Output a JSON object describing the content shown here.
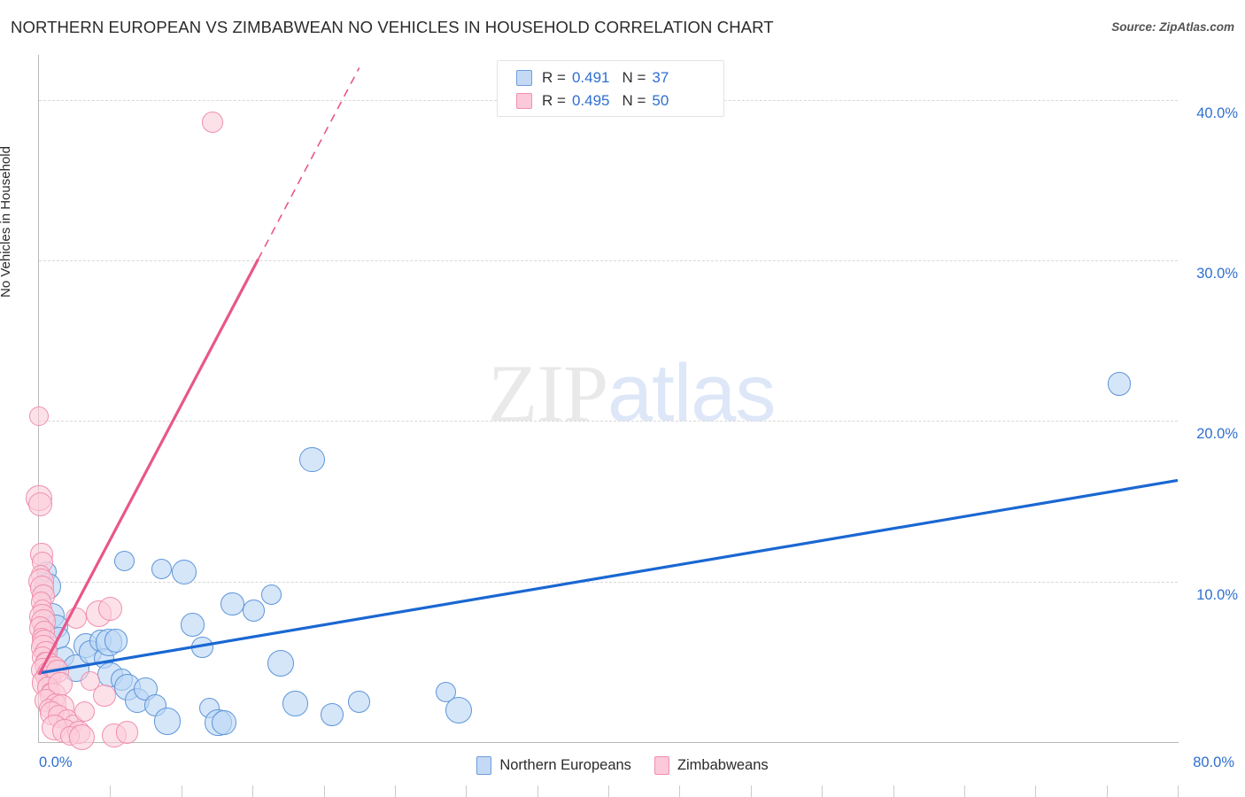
{
  "header": {
    "title": "NORTHERN EUROPEAN VS ZIMBABWEAN NO VEHICLES IN HOUSEHOLD CORRELATION CHART",
    "source": "Source: ZipAtlas.com"
  },
  "watermark": {
    "part1": "ZIP",
    "part2": "atlas"
  },
  "stats": {
    "rows": [
      {
        "series": "Northern Europeans",
        "r_label": "R =",
        "r_value": "0.491",
        "n_label": "N =",
        "n_value": "37",
        "color": "#c3d9f5"
      },
      {
        "series": "Zimbabweans",
        "r_label": "R =",
        "r_value": "0.495",
        "n_label": "N =",
        "n_value": "50",
        "color": "#fbc9da"
      }
    ]
  },
  "series_legend": [
    {
      "label": "Northern Europeans",
      "color": "#c3d9f5"
    },
    {
      "label": "Zimbabweans",
      "color": "#fbc9da"
    }
  ],
  "chart_data": {
    "type": "scatter",
    "title": "NORTHERN EUROPEAN VS ZIMBABWEAN NO VEHICLES IN HOUSEHOLD CORRELATION CHART",
    "xlabel": "",
    "ylabel": "No Vehicles in Household",
    "xlim": [
      0,
      80
    ],
    "ylim": [
      0,
      42.8
    ],
    "x_tick_labels": [
      "0.0%",
      "80.0%"
    ],
    "y_tick_labels": [
      "40.0%",
      "30.0%",
      "20.0%",
      "10.0%"
    ],
    "y_ticks": [
      40,
      30,
      20,
      10
    ],
    "x_ticks": [
      0,
      5,
      10,
      15,
      20,
      25,
      30,
      35,
      40,
      45,
      50,
      55,
      60,
      65,
      70,
      75,
      80
    ],
    "grid": true,
    "legend_position": "bottom-center",
    "series": [
      {
        "name": "Northern Europeans",
        "color": "#c3d9f5",
        "edge_color": "#5e95d8",
        "r": 0.491,
        "n": 37,
        "trend": {
          "x0": 0.0,
          "y0": 4.3,
          "x1": 80.0,
          "y1": 16.3,
          "dashed_from": null
        },
        "points": [
          [
            0.5,
            10.6
          ],
          [
            0.6,
            9.7
          ],
          [
            0.9,
            7.9
          ],
          [
            1.2,
            7.2
          ],
          [
            1.4,
            6.5
          ],
          [
            1.8,
            5.3
          ],
          [
            2.6,
            4.6
          ],
          [
            3.3,
            6.0
          ],
          [
            3.6,
            5.6
          ],
          [
            4.3,
            6.3
          ],
          [
            4.6,
            5.2
          ],
          [
            4.9,
            6.2
          ],
          [
            5.0,
            4.2
          ],
          [
            5.4,
            6.3
          ],
          [
            5.8,
            3.9
          ],
          [
            6.0,
            11.3
          ],
          [
            6.2,
            3.4
          ],
          [
            6.9,
            2.6
          ],
          [
            7.5,
            3.3
          ],
          [
            8.2,
            2.3
          ],
          [
            8.6,
            10.8
          ],
          [
            9.0,
            1.3
          ],
          [
            10.2,
            10.6
          ],
          [
            10.8,
            7.3
          ],
          [
            11.5,
            5.9
          ],
          [
            12.0,
            2.1
          ],
          [
            12.6,
            1.2
          ],
          [
            13.0,
            1.2
          ],
          [
            13.6,
            8.6
          ],
          [
            15.1,
            8.2
          ],
          [
            16.3,
            9.2
          ],
          [
            17.0,
            4.9
          ],
          [
            18.0,
            2.4
          ],
          [
            20.6,
            1.7
          ],
          [
            22.5,
            2.5
          ],
          [
            28.6,
            3.1
          ],
          [
            29.5,
            2.0
          ],
          [
            19.2,
            17.6
          ],
          [
            75.9,
            22.3
          ]
        ]
      },
      {
        "name": "Zimbabweans",
        "color": "#fbc9da",
        "edge_color": "#ef8fae",
        "r": 0.495,
        "n": 50,
        "trend": {
          "x0": 0.0,
          "y0": 4.2,
          "x1": 22.5,
          "y1": 42.0,
          "dashed_from": 15.4
        },
        "points": [
          [
            0.0,
            20.3
          ],
          [
            0.0,
            15.2
          ],
          [
            0.1,
            14.8
          ],
          [
            0.2,
            11.7
          ],
          [
            0.25,
            11.2
          ],
          [
            0.1,
            10.4
          ],
          [
            0.15,
            10.0
          ],
          [
            0.2,
            9.6
          ],
          [
            0.3,
            9.1
          ],
          [
            0.15,
            8.7
          ],
          [
            0.25,
            8.3
          ],
          [
            0.2,
            7.8
          ],
          [
            0.3,
            7.5
          ],
          [
            0.1,
            7.1
          ],
          [
            0.35,
            6.9
          ],
          [
            0.2,
            6.5
          ],
          [
            0.4,
            6.2
          ],
          [
            0.3,
            5.9
          ],
          [
            0.5,
            5.6
          ],
          [
            0.25,
            5.3
          ],
          [
            0.45,
            5.0
          ],
          [
            0.6,
            4.8
          ],
          [
            0.3,
            4.5
          ],
          [
            0.7,
            4.3
          ],
          [
            0.5,
            4.1
          ],
          [
            0.9,
            3.9
          ],
          [
            0.4,
            3.7
          ],
          [
            1.1,
            4.6
          ],
          [
            1.3,
            4.4
          ],
          [
            0.6,
            3.4
          ],
          [
            0.8,
            3.1
          ],
          [
            1.0,
            2.9
          ],
          [
            1.5,
            3.6
          ],
          [
            0.5,
            2.6
          ],
          [
            1.2,
            2.4
          ],
          [
            0.7,
            2.1
          ],
          [
            1.6,
            2.2
          ],
          [
            0.9,
            1.8
          ],
          [
            1.4,
            1.6
          ],
          [
            2.0,
            1.4
          ],
          [
            2.4,
            1.1
          ],
          [
            1.1,
            0.9
          ],
          [
            1.8,
            0.7
          ],
          [
            2.8,
            0.6
          ],
          [
            3.2,
            1.9
          ],
          [
            3.6,
            3.8
          ],
          [
            4.2,
            8.0
          ],
          [
            5.0,
            8.3
          ],
          [
            4.6,
            2.9
          ],
          [
            12.2,
            38.6
          ],
          [
            2.2,
            0.4
          ],
          [
            3.0,
            0.3
          ],
          [
            5.3,
            0.4
          ],
          [
            6.2,
            0.6
          ],
          [
            2.6,
            7.7
          ]
        ]
      }
    ]
  },
  "axis": {
    "y_title": "No Vehicles in Household",
    "x_left_label": "0.0%",
    "x_right_label": "80.0%",
    "y_labels": [
      "40.0%",
      "30.0%",
      "20.0%",
      "10.0%"
    ]
  },
  "colors": {
    "blue_fill": "#c3d9f5",
    "blue_edge": "#5e95d8",
    "blue_line": "#1a67d2",
    "pink_fill": "#fbc9da",
    "pink_edge": "#ef8fae",
    "pink_line": "#e8578a",
    "tick_text": "#2f6fd0",
    "grid": "#d8d8d8"
  }
}
